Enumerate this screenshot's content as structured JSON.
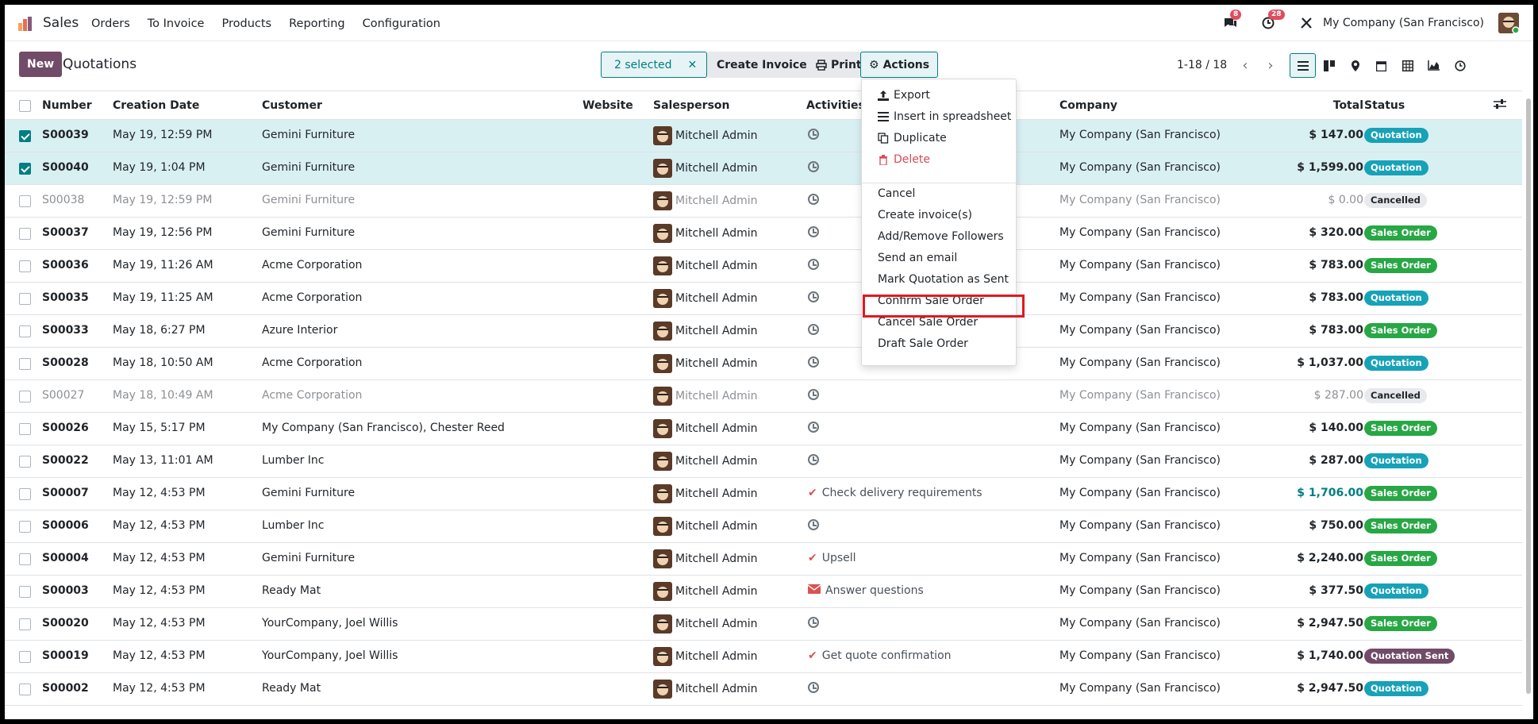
{
  "app": {
    "name": "Sales",
    "menu": [
      "Orders",
      "To Invoice",
      "Products",
      "Reporting",
      "Configuration"
    ],
    "company": "My Company (San Francisco)",
    "messages_count": "8",
    "activities_count": "28"
  },
  "control": {
    "new_label": "New",
    "title": "Quotations",
    "selected_label": "2 selected",
    "create_invoices_label": "Create Invoices",
    "print_label": "Print",
    "actions_label": "Actions",
    "pager": "1-18 / 18"
  },
  "columns": {
    "number": "Number",
    "creation_date": "Creation Date",
    "customer": "Customer",
    "website": "Website",
    "salesperson": "Salesperson",
    "activities": "Activities",
    "company": "Company",
    "total": "Total",
    "status": "Status"
  },
  "actions_menu": {
    "export": "Export",
    "spreadsheet": "Insert in spreadsheet",
    "duplicate": "Duplicate",
    "delete": "Delete",
    "cancel": "Cancel",
    "create_invoice": "Create invoice(s)",
    "followers": "Add/Remove Followers",
    "send_email": "Send an email",
    "mark_sent": "Mark Quotation as Sent",
    "confirm": "Confirm Sale Order",
    "cancel_order": "Cancel Sale Order",
    "draft": "Draft Sale Order"
  },
  "rows": [
    {
      "number": "S00039",
      "date": "May 19, 12:59 PM",
      "customer": "Gemini Furniture",
      "salesperson": "Mitchell Admin",
      "activity": "",
      "activity_icon": "clock",
      "company": "My Company (San Francisco)",
      "total": "$ 147.00",
      "status": "Quotation",
      "selected": true,
      "muted": false
    },
    {
      "number": "S00040",
      "date": "May 19, 1:04 PM",
      "customer": "Gemini Furniture",
      "salesperson": "Mitchell Admin",
      "activity": "",
      "activity_icon": "clock",
      "company": "My Company (San Francisco)",
      "total": "$ 1,599.00",
      "status": "Quotation",
      "selected": true,
      "muted": false
    },
    {
      "number": "S00038",
      "date": "May 19, 12:59 PM",
      "customer": "Gemini Furniture",
      "salesperson": "Mitchell Admin",
      "activity": "",
      "activity_icon": "clock",
      "company": "My Company (San Francisco)",
      "total": "$ 0.00",
      "status": "Cancelled",
      "selected": false,
      "muted": true
    },
    {
      "number": "S00037",
      "date": "May 19, 12:56 PM",
      "customer": "Gemini Furniture",
      "salesperson": "Mitchell Admin",
      "activity": "",
      "activity_icon": "clock",
      "company": "My Company (San Francisco)",
      "total": "$ 320.00",
      "status": "Sales Order",
      "selected": false,
      "muted": false
    },
    {
      "number": "S00036",
      "date": "May 19, 11:26 AM",
      "customer": "Acme Corporation",
      "salesperson": "Mitchell Admin",
      "activity": "",
      "activity_icon": "clock",
      "company": "My Company (San Francisco)",
      "total": "$ 783.00",
      "status": "Sales Order",
      "selected": false,
      "muted": false
    },
    {
      "number": "S00035",
      "date": "May 19, 11:25 AM",
      "customer": "Acme Corporation",
      "salesperson": "Mitchell Admin",
      "activity": "",
      "activity_icon": "clock",
      "company": "My Company (San Francisco)",
      "total": "$ 783.00",
      "status": "Quotation",
      "selected": false,
      "muted": false
    },
    {
      "number": "S00033",
      "date": "May 18, 6:27 PM",
      "customer": "Azure Interior",
      "salesperson": "Mitchell Admin",
      "activity": "",
      "activity_icon": "clock",
      "company": "My Company (San Francisco)",
      "total": "$ 783.00",
      "status": "Sales Order",
      "selected": false,
      "muted": false
    },
    {
      "number": "S00028",
      "date": "May 18, 10:50 AM",
      "customer": "Acme Corporation",
      "salesperson": "Mitchell Admin",
      "activity": "",
      "activity_icon": "clock",
      "company": "My Company (San Francisco)",
      "total": "$ 1,037.00",
      "status": "Quotation",
      "selected": false,
      "muted": false
    },
    {
      "number": "S00027",
      "date": "May 18, 10:49 AM",
      "customer": "Acme Corporation",
      "salesperson": "Mitchell Admin",
      "activity": "",
      "activity_icon": "clock",
      "company": "My Company (San Francisco)",
      "total": "$ 287.00",
      "status": "Cancelled",
      "selected": false,
      "muted": true
    },
    {
      "number": "S00026",
      "date": "May 15, 5:17 PM",
      "customer": "My Company (San Francisco), Chester Reed",
      "salesperson": "Mitchell Admin",
      "activity": "",
      "activity_icon": "clock",
      "company": "My Company (San Francisco)",
      "total": "$ 140.00",
      "status": "Sales Order",
      "selected": false,
      "muted": false
    },
    {
      "number": "S00022",
      "date": "May 13, 11:01 AM",
      "customer": "Lumber Inc",
      "salesperson": "Mitchell Admin",
      "activity": "",
      "activity_icon": "clock",
      "company": "My Company (San Francisco)",
      "total": "$ 287.00",
      "status": "Quotation",
      "selected": false,
      "muted": false
    },
    {
      "number": "S00007",
      "date": "May 12, 4:53 PM",
      "customer": "Gemini Furniture",
      "salesperson": "Mitchell Admin",
      "activity": "Check delivery requirements",
      "activity_icon": "check",
      "company": "My Company (San Francisco)",
      "total": "$ 1,706.00",
      "status": "Sales Order",
      "selected": false,
      "muted": false,
      "total_color": "#017e84"
    },
    {
      "number": "S00006",
      "date": "May 12, 4:53 PM",
      "customer": "Lumber Inc",
      "salesperson": "Mitchell Admin",
      "activity": "",
      "activity_icon": "clock",
      "company": "My Company (San Francisco)",
      "total": "$ 750.00",
      "status": "Sales Order",
      "selected": false,
      "muted": false
    },
    {
      "number": "S00004",
      "date": "May 12, 4:53 PM",
      "customer": "Gemini Furniture",
      "salesperson": "Mitchell Admin",
      "activity": "Upsell",
      "activity_icon": "check",
      "company": "My Company (San Francisco)",
      "total": "$ 2,240.00",
      "status": "Sales Order",
      "selected": false,
      "muted": false
    },
    {
      "number": "S00003",
      "date": "May 12, 4:53 PM",
      "customer": "Ready Mat",
      "salesperson": "Mitchell Admin",
      "activity": "Answer questions",
      "activity_icon": "envelope",
      "company": "My Company (San Francisco)",
      "total": "$ 377.50",
      "status": "Quotation",
      "selected": false,
      "muted": false
    },
    {
      "number": "S00020",
      "date": "May 12, 4:53 PM",
      "customer": "YourCompany, Joel Willis",
      "salesperson": "Mitchell Admin",
      "activity": "",
      "activity_icon": "clock",
      "company": "My Company (San Francisco)",
      "total": "$ 2,947.50",
      "status": "Sales Order",
      "selected": false,
      "muted": false
    },
    {
      "number": "S00019",
      "date": "May 12, 4:53 PM",
      "customer": "YourCompany, Joel Willis",
      "salesperson": "Mitchell Admin",
      "activity": "Get quote confirmation",
      "activity_icon": "check",
      "company": "My Company (San Francisco)",
      "total": "$ 1,740.00",
      "status": "Quotation Sent",
      "selected": false,
      "muted": false
    },
    {
      "number": "S00002",
      "date": "May 12, 4:53 PM",
      "customer": "Ready Mat",
      "salesperson": "Mitchell Admin",
      "activity": "",
      "activity_icon": "clock",
      "company": "My Company (San Francisco)",
      "total": "$ 2,947.50",
      "status": "Quotation",
      "selected": false,
      "muted": false
    }
  ],
  "status_colors": {
    "Quotation": "#17a2b8",
    "Sales Order": "#28a745",
    "Cancelled": "#e7e9ed",
    "Quotation Sent": "#714b67"
  },
  "colors": {
    "brand": "#714b67",
    "accent": "#017e84",
    "danger": "#e0191f"
  }
}
